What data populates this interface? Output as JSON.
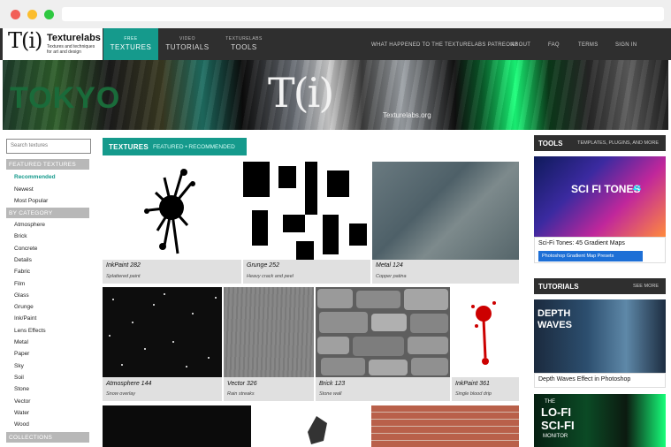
{
  "site": {
    "logo_mark": "T(i)",
    "name": "Texturelabs",
    "tagline": "Textures and techniques for art and design"
  },
  "nav": {
    "tabs": [
      {
        "small": "FREE",
        "big": "TEXTURES"
      },
      {
        "small": "VIDEO",
        "big": "TUTORIALS"
      },
      {
        "small": "TEXTURELABS",
        "big": "TOOLS"
      }
    ],
    "links": [
      "WHAT HAPPENED TO THE TEXTURELABS PATREON?",
      "ABOUT",
      "FAQ",
      "TERMS",
      "SIGN IN"
    ]
  },
  "banner": {
    "mark": "T(i)",
    "site": "Texturelabs.org",
    "word": "TOKYO"
  },
  "sidebar": {
    "search_placeholder": "Search textures",
    "featured_header": "FEATURED TEXTURES",
    "featured": [
      "Recommended",
      "Newest",
      "Most Popular"
    ],
    "category_header": "BY CATEGORY",
    "categories": [
      "Atmosphere",
      "Brick",
      "Concrete",
      "Details",
      "Fabric",
      "Film",
      "Glass",
      "Grunge",
      "Ink/Paint",
      "Lens Effects",
      "Metal",
      "Paper",
      "Sky",
      "Soil",
      "Stone",
      "Vector",
      "Water",
      "Wood"
    ],
    "collections_header": "COLLECTIONS"
  },
  "textures": {
    "header": "TEXTURES",
    "subheader": "FEATURED • RECOMMENDED",
    "cards": [
      {
        "title": "InkPaint 282",
        "sub": "Splattered paint"
      },
      {
        "title": "Grunge 252",
        "sub": "Heavy crack and peel"
      },
      {
        "title": "Metal 124",
        "sub": "Copper patina"
      },
      {
        "title": "Atmosphere 144",
        "sub": "Snow overlay"
      },
      {
        "title": "Vector 326",
        "sub": "Rain streaks"
      },
      {
        "title": "Brick 123",
        "sub": "Stone wall"
      },
      {
        "title": "InkPaint 361",
        "sub": "Single blood drip"
      }
    ]
  },
  "right": {
    "tools_header": "TOOLS",
    "tools_link": "TEMPLATES, PLUGINS, AND MORE",
    "tool_art_title": "SCI FI TONES",
    "tool_art_count": "45",
    "tool_caption": "Sci-Fi Tones: 45 Gradient Maps",
    "tool_badge": "Photoshop Gradient Map Presets",
    "tutorials_header": "TUTORIALS",
    "tutorials_link": "SEE MORE",
    "tut1_art": "DEPTH WAVES",
    "tut1_caption": "Depth Waves Effect in Photoshop",
    "tut2_art_1": "THE",
    "tut2_art_2": "LO-FI",
    "tut2_art_3": "SCI-FI",
    "tut2_art_4": "MONITOR"
  },
  "colors": {
    "accent": "#159a8c",
    "nav_bg": "#2f2f2f",
    "sidebar_header": "#b8b8b8"
  }
}
